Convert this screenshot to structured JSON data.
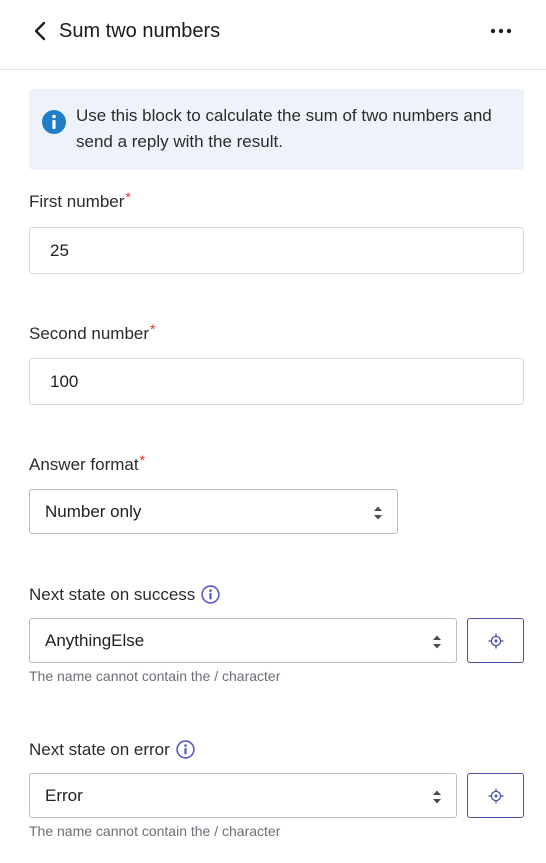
{
  "header": {
    "title": "Sum two numbers",
    "back_icon": "chevron-left-icon",
    "more_icon": "more-horizontal-icon"
  },
  "info": {
    "text": "Use this block to calculate the sum of two numbers and send a reply with the result.",
    "icon": "info-icon"
  },
  "fields": {
    "first_number": {
      "label": "First number",
      "required_mark": "*",
      "value": "25"
    },
    "second_number": {
      "label": "Second number",
      "required_mark": "*",
      "value": "100"
    },
    "answer_format": {
      "label": "Answer format",
      "required_mark": "*",
      "selected": "Number only"
    },
    "next_state_success": {
      "label": "Next state on success",
      "selected": "AnythingElse",
      "hint": "The name cannot contain the / character"
    },
    "next_state_error": {
      "label": "Next state on error",
      "selected": "Error",
      "hint": "The name cannot contain the / character"
    }
  },
  "colors": {
    "accent": "#4a4fae",
    "info_bg": "#eef3fb",
    "info_icon": "#1e7fc6",
    "required": "#e5322d",
    "help_icon": "#5b57c9"
  }
}
